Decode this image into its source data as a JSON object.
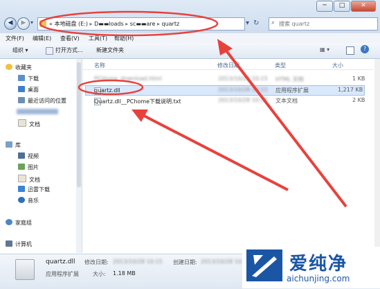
{
  "window": {
    "nav_back": "◀",
    "nav_forward": "▶",
    "controls": {
      "minimize": "─",
      "maximize": "□",
      "close": "✕"
    }
  },
  "address": {
    "segments": [
      "«",
      "本地磁盘 (E:)",
      "▸",
      "D▬▬loads",
      "▸",
      "sc▬▬are",
      "▸",
      "quartz"
    ],
    "dropdown": "▾",
    "refresh": "↻",
    "search_placeholder": "搜索 quartz"
  },
  "menubar": [
    "文件(F)",
    "编辑(E)",
    "查看(V)",
    "工具(T)",
    "帮助(H)"
  ],
  "toolbar": {
    "organize": "组织 ▾",
    "open": "打开方式...",
    "new_folder": "新建文件夹",
    "view": "▦ ▾"
  },
  "sidebar": {
    "favorites": {
      "header": "收藏夹",
      "items": [
        "下载",
        "桌面",
        "最近访问的位置"
      ]
    },
    "docs": "文档",
    "libraries": {
      "header": "库",
      "items": [
        "视频",
        "图片",
        "文档",
        "迅雷下载",
        "音乐"
      ]
    },
    "homegroup": "家庭组",
    "computer": "计算机"
  },
  "columns": {
    "name": "名称",
    "modified": "修改日期",
    "type": "类型",
    "size": "大小"
  },
  "files": [
    {
      "name": "PCHome_download.html",
      "date": "2013/10/28 10:15",
      "type": "HTML 文档",
      "size": "1 KB",
      "blurred": true
    },
    {
      "name": "quartz.dll",
      "date": "2013/10/28 10:15",
      "type": "应用程序扩展",
      "size": "1,217 KB",
      "selected": true
    },
    {
      "name": "Quartz.dll__PChome下载说明.txt",
      "date": "2013/10/28 10:15",
      "type": "文本文档",
      "size": "2 KB"
    }
  ],
  "details": {
    "name": "quartz.dll",
    "kind": "应用程序扩展",
    "modified_label": "修改日期:",
    "modified_value": "2013/10/28 10:15",
    "created_label": "创建日期:",
    "created_value": "2013/10/28 10:15",
    "size_label": "大小:",
    "size_value": "1.18 MB"
  },
  "watermark": {
    "brand": "爱纯净",
    "url": "aichunjing.com"
  },
  "colors": {
    "annotation": "#e8413c",
    "brand_blue": "#1b56a5",
    "selection": "#d9e8fb"
  }
}
